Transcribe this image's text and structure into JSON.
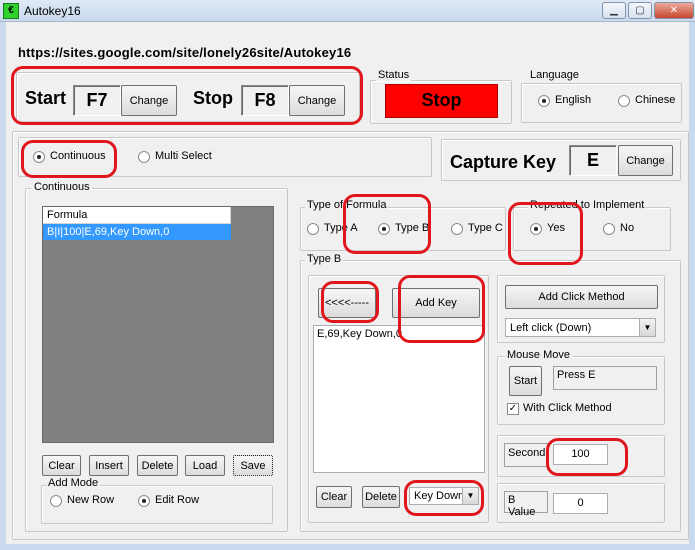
{
  "window": {
    "title": "Autokey16",
    "icon_char": "€",
    "minimize": "▁",
    "maximize": "▢",
    "close": "✕"
  },
  "url": "https://sites.google.com/site/lonely26site/Autokey16",
  "hotkeys": {
    "start_label": "Start",
    "start_key": "F7",
    "stop_label": "Stop",
    "stop_key": "F8",
    "change_label": "Change"
  },
  "status": {
    "legend": "Status",
    "value": "Stop",
    "color": "#ff0000"
  },
  "language": {
    "legend": "Language",
    "options": [
      "English",
      "Chinese"
    ],
    "selected": "English"
  },
  "mode": {
    "options": [
      "Continuous",
      "Multi Select"
    ],
    "selected": "Continuous"
  },
  "capture": {
    "label": "Capture Key",
    "key": "E",
    "change_label": "Change"
  },
  "continuous": {
    "legend": "Continuous",
    "list_header": "Formula",
    "list_items": [
      "B|I|100|E,69,Key Down,0"
    ],
    "buttons": [
      "Clear",
      "Insert",
      "Delete",
      "Load",
      "Save"
    ],
    "add_mode": {
      "legend": "Add Mode",
      "options": [
        "New Row",
        "Edit Row"
      ],
      "selected": "Edit Row"
    }
  },
  "type_of_formula": {
    "legend": "Type of Formula",
    "options": [
      "Type A",
      "Type B",
      "Type C"
    ],
    "selected": "Type B"
  },
  "repeated": {
    "legend": "Repeated to Implement",
    "options": [
      "Yes",
      "No"
    ],
    "selected": "Yes"
  },
  "type_b": {
    "legend": "Type B",
    "back_label": "<<<<-----",
    "add_key_label": "Add Key",
    "key_list": [
      "E,69,Key Down,0"
    ],
    "clear_label": "Clear",
    "delete_label": "Delete",
    "key_action": "Key Down"
  },
  "click": {
    "add_click_label": "Add Click Method",
    "method": "Left click (Down)"
  },
  "mouse_move": {
    "legend": "Mouse Move",
    "start_label": "Start",
    "hint": "Press E",
    "with_click_label": "With Click Method",
    "with_click_checked": true
  },
  "second": {
    "label": "Second",
    "value": "100"
  },
  "b_value": {
    "label": "B Value",
    "value": "0"
  },
  "colors": {
    "annotation": "#e0161d",
    "selection": "#3399ff",
    "list_bg": "#808080"
  }
}
